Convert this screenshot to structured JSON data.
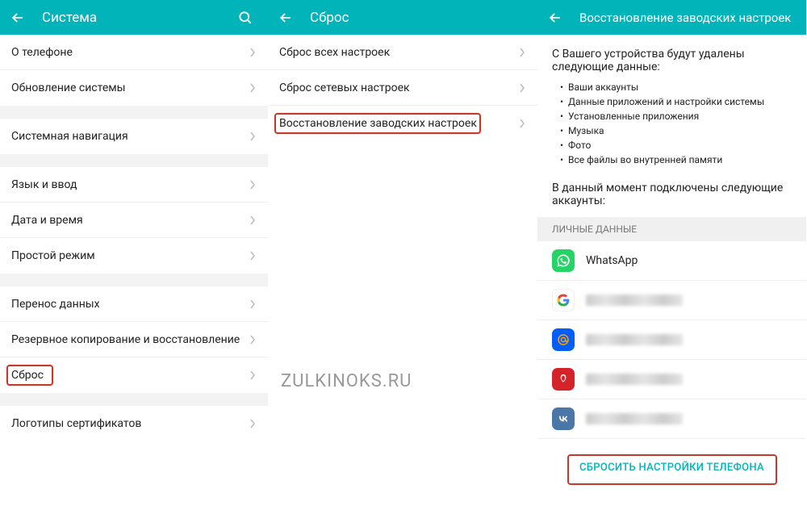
{
  "pane1": {
    "title": "Система",
    "items": [
      {
        "label": "О телефоне"
      },
      {
        "label": "Обновление системы"
      },
      {
        "label": "Системная навигация"
      },
      {
        "label": "Язык и ввод"
      },
      {
        "label": "Дата и время"
      },
      {
        "label": "Простой режим"
      },
      {
        "label": "Перенос данных"
      },
      {
        "label": "Резервное копирование и восстановление"
      },
      {
        "label": "Сброс"
      },
      {
        "label": "Логотипы сертификатов"
      }
    ]
  },
  "pane2": {
    "title": "Сброс",
    "items": [
      {
        "label": "Сброс всех настроек"
      },
      {
        "label": "Сброс сетевых настроек"
      },
      {
        "label": "Восстановление заводских настроек"
      }
    ]
  },
  "pane3": {
    "title": "Восстановление заводских настроек",
    "desc_title": "С Вашего устройства будут удалены следующие данные:",
    "bullets": [
      "Ваши аккаунты",
      "Данные приложений и настройки системы",
      "Установленные приложения",
      "Музыка",
      "Фото",
      "Все файлы во внутренней памяти"
    ],
    "connected_text": "В данный момент подключены следующие аккаунты:",
    "section_header": "ЛИЧНЫЕ ДАННЫЕ",
    "accounts": [
      {
        "icon": "whatsapp",
        "label": "WhatsApp",
        "blurred": false
      },
      {
        "icon": "google",
        "label": "",
        "blurred": true
      },
      {
        "icon": "mailru",
        "label": "",
        "blurred": true
      },
      {
        "icon": "huawei",
        "label": "",
        "blurred": true
      },
      {
        "icon": "vk",
        "label": "",
        "blurred": true
      }
    ],
    "reset_button": "СБРОСИТЬ НАСТРОЙКИ ТЕЛЕФОНА"
  },
  "watermark": "ZULKINOKS.RU"
}
